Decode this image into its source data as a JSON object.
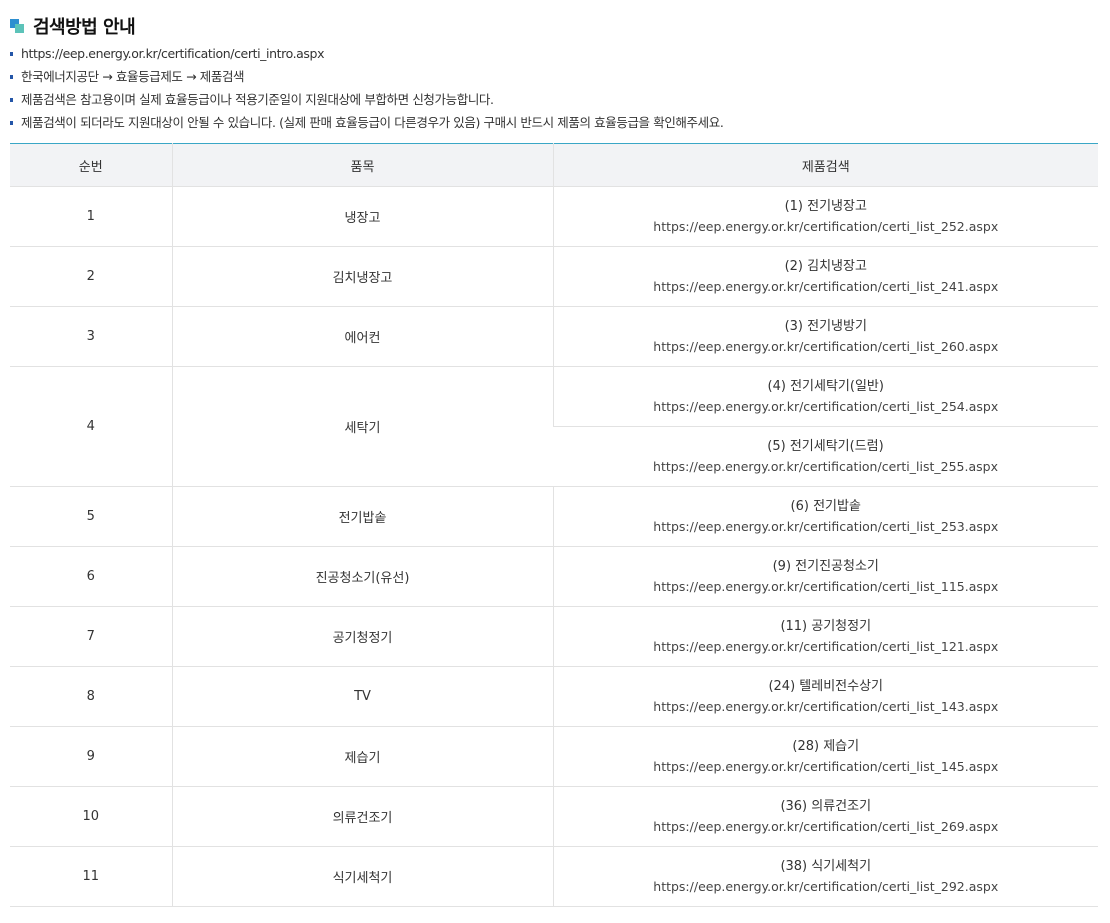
{
  "title": "검색방법 안내",
  "bullets": [
    "https://eep.energy.or.kr/certification/certi_intro.aspx",
    "한국에너지공단 → 효율등급제도 → 제품검색",
    "제품검색은 참고용이며 실제 효율등급이나 적용기준일이 지원대상에 부합하면 신청가능합니다.",
    "제품검색이 되더라도 지원대상이 안될 수 있습니다. (실제 판매 효율등급이 다른경우가 있음) 구매시 반드시 제품의 효율등급을 확인해주세요."
  ],
  "table": {
    "headers": [
      "순번",
      "품목",
      "제품검색"
    ],
    "rows": [
      {
        "no": "1",
        "item": "냉장고",
        "searches": [
          {
            "label": "(1) 전기냉장고",
            "url": "https://eep.energy.or.kr/certification/certi_list_252.aspx"
          }
        ]
      },
      {
        "no": "2",
        "item": "김치냉장고",
        "searches": [
          {
            "label": "(2) 김치냉장고",
            "url": "https://eep.energy.or.kr/certification/certi_list_241.aspx"
          }
        ]
      },
      {
        "no": "3",
        "item": "에어컨",
        "searches": [
          {
            "label": "(3) 전기냉방기",
            "url": "https://eep.energy.or.kr/certification/certi_list_260.aspx"
          }
        ]
      },
      {
        "no": "4",
        "item": "세탁기",
        "searches": [
          {
            "label": "(4) 전기세탁기(일반)",
            "url": "https://eep.energy.or.kr/certification/certi_list_254.aspx"
          },
          {
            "label": "(5) 전기세탁기(드럼)",
            "url": "https://eep.energy.or.kr/certification/certi_list_255.aspx"
          }
        ]
      },
      {
        "no": "5",
        "item": "전기밥솥",
        "searches": [
          {
            "label": "(6) 전기밥솥",
            "url": "https://eep.energy.or.kr/certification/certi_list_253.aspx"
          }
        ]
      },
      {
        "no": "6",
        "item": "진공청소기(유선)",
        "searches": [
          {
            "label": "(9) 전기진공청소기",
            "url": "https://eep.energy.or.kr/certification/certi_list_115.aspx"
          }
        ]
      },
      {
        "no": "7",
        "item": "공기청정기",
        "searches": [
          {
            "label": "(11) 공기청정기",
            "url": "https://eep.energy.or.kr/certification/certi_list_121.aspx"
          }
        ]
      },
      {
        "no": "8",
        "item": "TV",
        "searches": [
          {
            "label": "(24) 텔레비전수상기",
            "url": "https://eep.energy.or.kr/certification/certi_list_143.aspx"
          }
        ]
      },
      {
        "no": "9",
        "item": "제습기",
        "searches": [
          {
            "label": "(28) 제습기",
            "url": "https://eep.energy.or.kr/certification/certi_list_145.aspx"
          }
        ]
      },
      {
        "no": "10",
        "item": "의류건조기",
        "searches": [
          {
            "label": "(36) 의류건조기",
            "url": "https://eep.energy.or.kr/certification/certi_list_269.aspx"
          }
        ]
      },
      {
        "no": "11",
        "item": "식기세척기",
        "searches": [
          {
            "label": "(38) 식기세척기",
            "url": "https://eep.energy.or.kr/certification/certi_list_292.aspx"
          }
        ]
      }
    ]
  },
  "colors": {
    "accent_line": "#3aa7c6",
    "bullet_dot": "#2456a8",
    "header_bg": "#f2f3f5"
  },
  "icons": {
    "title": "two-squares-icon",
    "bullet": "square-bullet-icon"
  }
}
